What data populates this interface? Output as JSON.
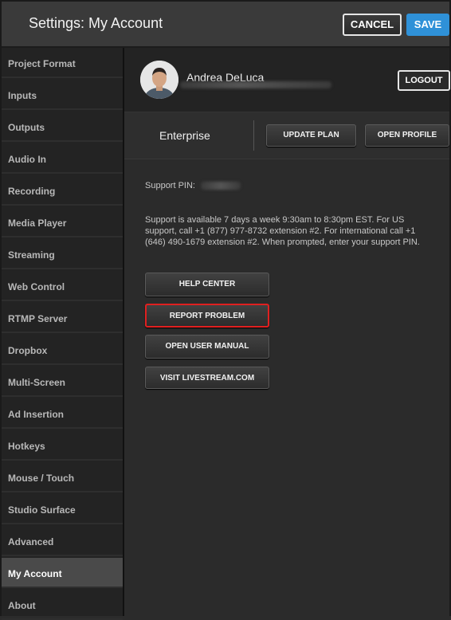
{
  "header": {
    "title": "Settings: My Account",
    "cancel_label": "CANCEL",
    "save_label": "SAVE"
  },
  "sidebar": {
    "items": [
      {
        "label": "Project Format"
      },
      {
        "label": "Inputs"
      },
      {
        "label": "Outputs"
      },
      {
        "label": "Audio In"
      },
      {
        "label": "Recording"
      },
      {
        "label": "Media Player"
      },
      {
        "label": "Streaming"
      },
      {
        "label": "Web Control"
      },
      {
        "label": "RTMP Server"
      },
      {
        "label": "Dropbox"
      },
      {
        "label": "Multi-Screen"
      },
      {
        "label": "Ad Insertion"
      },
      {
        "label": "Hotkeys"
      },
      {
        "label": "Mouse / Touch"
      },
      {
        "label": "Studio Surface"
      },
      {
        "label": "Advanced"
      },
      {
        "label": "My Account"
      },
      {
        "label": "About"
      }
    ],
    "active": "My Account"
  },
  "account": {
    "name": "Andrea DeLuca",
    "logout_label": "LOGOUT"
  },
  "plan": {
    "name": "Enterprise",
    "update_label": "UPDATE PLAN",
    "profile_label": "OPEN PROFILE"
  },
  "support": {
    "pin_label": "Support PIN:",
    "text": "Support is available 7 days a week 9:30am to 8:30pm EST. For US support, call +1 (877) 977-8732 extension #2. For international call +1 (646) 490-1679 extension #2. When prompted, enter your support PIN."
  },
  "actions": {
    "help_label": "HELP CENTER",
    "report_label": "REPORT PROBLEM",
    "manual_label": "OPEN USER MANUAL",
    "visit_label": "VISIT LIVESTREAM.COM"
  },
  "colors": {
    "accent_blue": "#2f91d8",
    "highlight_red": "#e02020",
    "active_item": "#4a4a4a"
  }
}
